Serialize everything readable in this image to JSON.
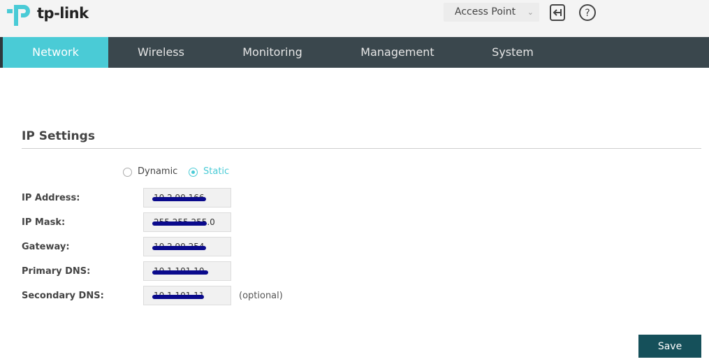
{
  "header": {
    "logo_text": "tp-link",
    "mode_value": "Access Point"
  },
  "nav": {
    "items": [
      {
        "label": "Network",
        "active": true
      },
      {
        "label": "Wireless"
      },
      {
        "label": "Monitoring"
      },
      {
        "label": "Management"
      },
      {
        "label": "System"
      }
    ]
  },
  "ip_settings": {
    "title": "IP Settings",
    "mode_options": {
      "dynamic": "Dynamic",
      "static": "Static",
      "selected": "Static"
    },
    "fields": {
      "ip_address": {
        "label": "IP Address:",
        "value": "10.2.90.166"
      },
      "ip_mask": {
        "label": "IP Mask:",
        "value": "255.255.255.0"
      },
      "gateway": {
        "label": "Gateway:",
        "value": "10.2.90.254"
      },
      "primary_dns": {
        "label": "Primary DNS:",
        "value": "10.1.101.10"
      },
      "secondary_dns": {
        "label": "Secondary DNS:",
        "value": "10.1.101.11"
      }
    },
    "optional_note": "(optional)"
  },
  "actions": {
    "save_label": "Save"
  },
  "colors": {
    "accent": "#4acbd6",
    "nav_bg": "#3a474d",
    "save_bg": "#15505a",
    "redaction": "#0a0a8c"
  }
}
